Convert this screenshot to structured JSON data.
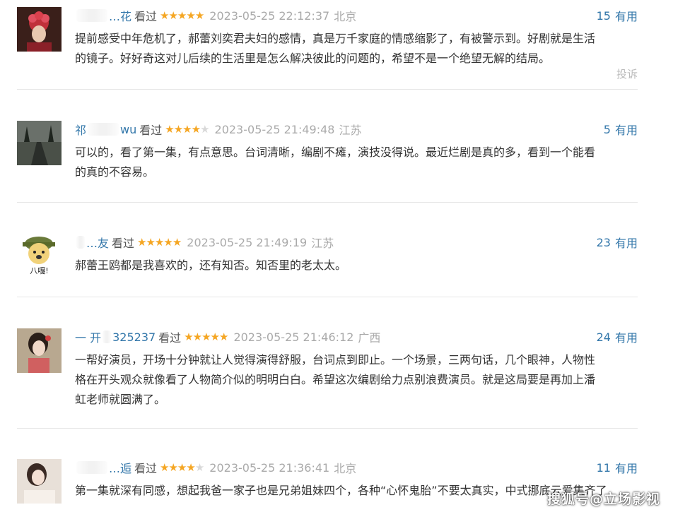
{
  "colors": {
    "username": "#3377aa",
    "star_on": "#f5a623",
    "star_off": "#d8d8d8",
    "muted": "#aaaaaa",
    "useful": "#3377aa"
  },
  "reviews": [
    {
      "username": "…花",
      "watched": "看过",
      "stars_filled": 5,
      "stars_total": 5,
      "time": "2023-05-25 22:12:37",
      "location": "北京",
      "useful_count": "15",
      "useful_label": "有用",
      "line1": "提前感受中年危机了，郝蕾刘奕君夫妇的感情，真是万千家庭的情感缩影了，有被警示到。好剧就是生活",
      "line2": "的镜子。好好奇这对儿后续的生活里是怎么解决彼此的问题的，希望不是一个绝望无解的结局。",
      "report": "投诉",
      "avatar": "red-flower-portrait"
    },
    {
      "username_pre": "祁",
      "username_post": "wu",
      "watched": "看过",
      "stars_filled": 4,
      "stars_total": 5,
      "time": "2023-05-25 21:49:48",
      "location": "江苏",
      "useful_count": "5",
      "useful_label": "有用",
      "line1": "可以的，看了第一集，有点意思。台词清晰，编剧不瘫，演技没得说。最近烂剧是真的多，看到一个能看",
      "line2": "的真的不容易。",
      "avatar": "dark-forest-road"
    },
    {
      "username": "…友",
      "watched": "看过",
      "stars_filled": 5,
      "stars_total": 5,
      "time": "2023-05-25 21:49:19",
      "location": "江苏",
      "useful_count": "23",
      "useful_label": "有用",
      "line1": "郝蕾王鸥都是我喜欢的，还有知否。知否里的老太太。",
      "avatar": "cartoon-dog-soldier",
      "avatar_text": "八嘎!"
    },
    {
      "username_pre": "一 开",
      "username_post": "325237",
      "watched": "看过",
      "stars_filled": 5,
      "stars_total": 5,
      "time": "2023-05-25 21:46:12",
      "location": "广西",
      "useful_count": "24",
      "useful_label": "有用",
      "line1": "一帮好演员，开场十分钟就让人觉得演得舒服，台词点到即止。一个场景，三两句话，几个眼神，人物性",
      "line2": "格在开头观众就像看了人物简介似的明明白白。希望这次编剧给力点别浪费演员。就是这局要是再加上潘",
      "line3": "虹老师就圆满了。",
      "avatar": "woman-portrait"
    },
    {
      "username": "…逅",
      "watched": "看过",
      "stars_filled": 4,
      "stars_total": 5,
      "time": "2023-05-25 21:36:41",
      "location": "北京",
      "useful_count": "11",
      "useful_label": "有用",
      "line1": "第一集就深有同感，想起我爸一家子也是兄弟姐妹四个，各种“心怀鬼胎”不要太真实，中式挪底云爱集齐了",
      "avatar": "girl-portrait"
    }
  ],
  "watermark": "搜狐号@立场影视"
}
